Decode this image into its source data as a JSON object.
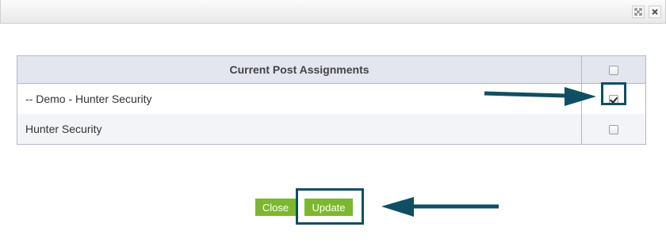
{
  "table": {
    "header": "Current Post Assignments",
    "rows": [
      {
        "label": "-- Demo - Hunter Security",
        "checked": true
      },
      {
        "label": "Hunter Security",
        "checked": false
      }
    ]
  },
  "buttons": {
    "close_label": "Close",
    "update_label": "Update"
  },
  "colors": {
    "accent_green": "#7cb82f",
    "annotation": "#0f4f63",
    "header_bg": "#e3e6ef"
  },
  "icons": {
    "titlebar": [
      "expand-icon",
      "close-icon"
    ]
  }
}
